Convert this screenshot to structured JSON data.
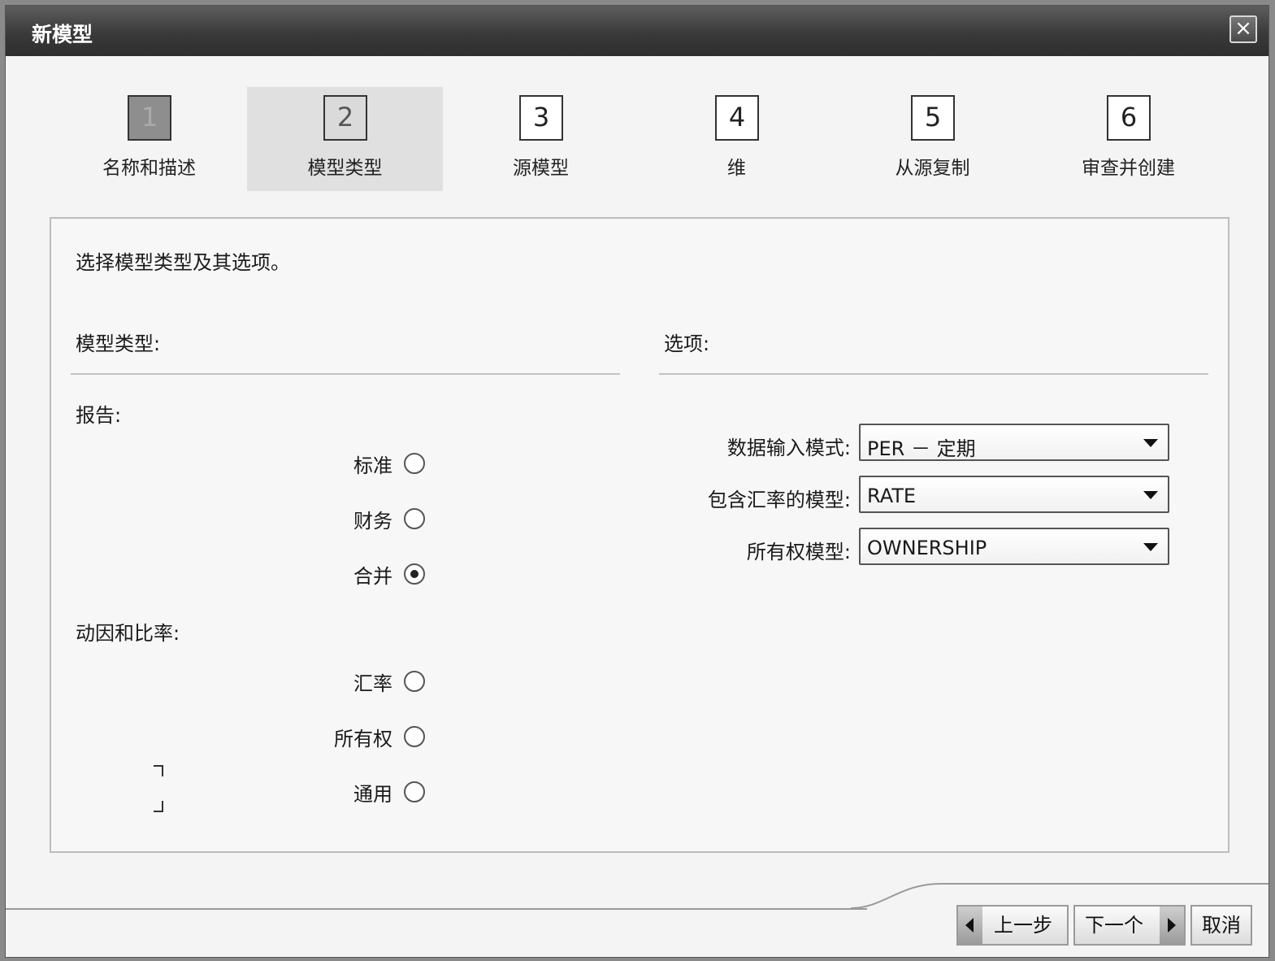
{
  "window": {
    "title": "新模型",
    "close_icon": "×"
  },
  "steps": [
    {
      "number": "1",
      "label": "名称和描述",
      "state": "done"
    },
    {
      "number": "2",
      "label": "模型类型",
      "state": "active"
    },
    {
      "number": "3",
      "label": "源模型",
      "state": "pending"
    },
    {
      "number": "4",
      "label": "维",
      "state": "pending"
    },
    {
      "number": "5",
      "label": "从源复制",
      "state": "pending"
    },
    {
      "number": "6",
      "label": "审查并创建",
      "state": "pending"
    }
  ],
  "panel": {
    "instruction": "选择模型类型及其选项。",
    "model_type_heading": "模型类型:",
    "options_heading": "选项:",
    "groups": {
      "report_label": "报告:",
      "driver_label": "动因和比率:"
    },
    "radios": {
      "standard": {
        "label": "标准",
        "checked": false
      },
      "finance": {
        "label": "财务",
        "checked": false
      },
      "consolidation": {
        "label": "合并",
        "checked": true
      },
      "rate": {
        "label": "汇率",
        "checked": false
      },
      "ownership": {
        "label": "所有权",
        "checked": false
      },
      "generic": {
        "label": "通用",
        "checked": false
      }
    },
    "options": {
      "data_entry_mode": {
        "label": "数据输入模式:",
        "value": "PER － 定期"
      },
      "rate_model": {
        "label": "包含汇率的模型:",
        "value": "RATE"
      },
      "ownership_model": {
        "label": "所有权模型:",
        "value": "OWNERSHIP"
      }
    }
  },
  "footer": {
    "prev_label": "上一步",
    "next_label": "下一个",
    "cancel_label": "取消"
  }
}
